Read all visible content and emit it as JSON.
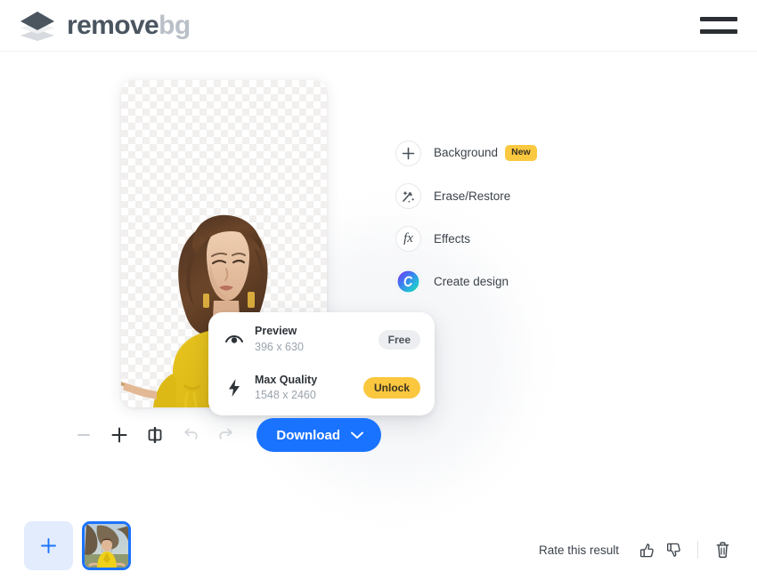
{
  "header": {
    "brand_primary": "remove",
    "brand_secondary": "bg",
    "logo_icon": "layers-diamond-icon",
    "menu_icon": "hamburger-menu-icon"
  },
  "editor": {
    "canvas_alt": "woman-in-yellow-dress-holding-paintbrush-transparent-background",
    "checker_pattern": "transparency-checkerboard"
  },
  "download_popup": {
    "options": [
      {
        "icon": "eye-icon",
        "title": "Preview",
        "dimensions": "396 x 630",
        "badge": "Free",
        "badge_type": "free"
      },
      {
        "icon": "lightning-bolt-icon",
        "title": "Max Quality",
        "dimensions": "1548 x 2460",
        "badge": "Unlock",
        "badge_type": "unlock"
      }
    ]
  },
  "toolbar": {
    "zoom_out_icon": "minus-icon",
    "zoom_in_icon": "plus-icon",
    "compare_icon": "compare-split-icon",
    "undo_icon": "undo-arrow-icon",
    "redo_icon": "redo-arrow-icon",
    "download_label": "Download",
    "download_chevron_icon": "chevron-down-icon",
    "download_color": "#1a73ff"
  },
  "tools": {
    "items": [
      {
        "label": "Background",
        "icon": "plus-icon",
        "badge": "New"
      },
      {
        "label": "Erase/Restore",
        "icon": "magic-wand-icon",
        "badge": ""
      },
      {
        "label": "Effects",
        "icon": "fx-icon",
        "badge": ""
      },
      {
        "label": "Create design",
        "icon": "canva-circle-icon",
        "badge": ""
      }
    ]
  },
  "bottom": {
    "add_image_icon": "plus-icon",
    "thumbnail_alt": "woman-meditating-in-yellow-outfit-by-tree",
    "rate_label": "Rate this result",
    "thumbs_up_icon": "thumbs-up-icon",
    "thumbs_down_icon": "thumbs-down-icon",
    "delete_icon": "trash-icon"
  },
  "colors": {
    "accent_blue": "#1a73ff",
    "accent_yellow": "#fbc93f",
    "text_dark": "#3c434b",
    "text_muted": "#9aa3ad"
  }
}
